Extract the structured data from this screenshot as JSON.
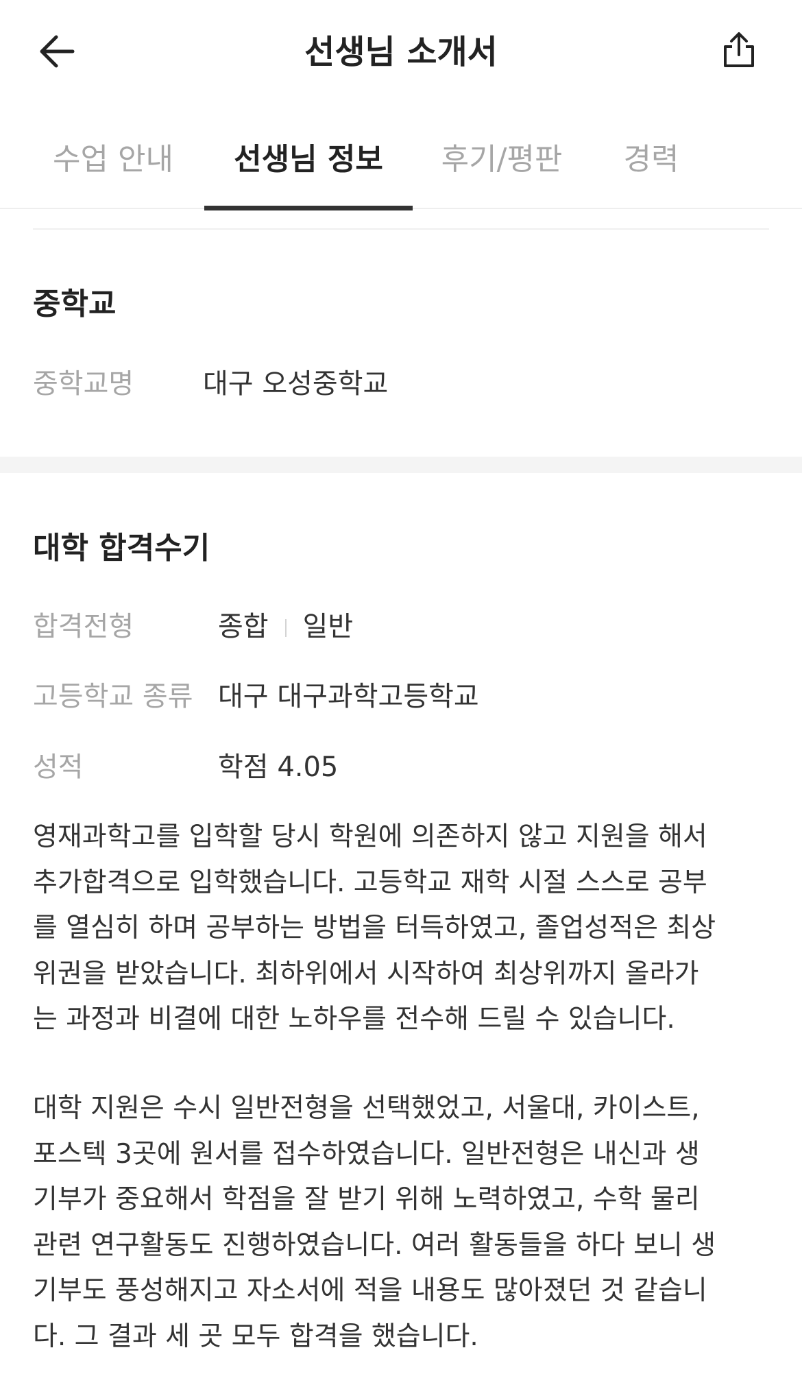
{
  "header": {
    "title": "선생님 소개서",
    "back_icon": "arrow-left-icon",
    "share_icon": "share-icon"
  },
  "tabs": [
    {
      "label": "수업 안내",
      "active": false
    },
    {
      "label": "선생님 정보",
      "active": true
    },
    {
      "label": "후기/평판",
      "active": false
    },
    {
      "label": "경력",
      "active": false
    }
  ],
  "middle_school": {
    "title": "중학교",
    "name_label": "중학교명",
    "name_value": "대구 오성중학교"
  },
  "admission": {
    "title": "대학 합격수기",
    "type_label": "합격전형",
    "type_values": [
      "종합",
      "일반"
    ],
    "school_label": "고등학교 종류",
    "school_value": "대구 대구과학고등학교",
    "grade_label": "성적",
    "grade_value": "학점 4.05",
    "paragraph1": "영재과학고를 입학할 당시 학원에 의존하지 않고 지원을 해서\n추가합격으로 입학했습니다. 고등학교 재학 시절 스스로 공부\n를 열심히 하며 공부하는 방법을 터득하였고, 졸업성적은 최상\n위권을 받았습니다. 최하위에서 시작하여 최상위까지 올라가\n는 과정과 비결에 대한 노하우를 전수해 드릴 수 있습니다.",
    "paragraph2": "대학 지원은 수시 일반전형을 선택했었고, 서울대, 카이스트,\n포스텍 3곳에 원서를 접수하였습니다. 일반전형은 내신과 생\n기부가 중요해서 학점을 잘 받기 위해 노력하였고, 수학 물리\n관련 연구활동도 진행하였습니다. 여러 활동들을 하다 보니 생\n기부도 풍성해지고 자소서에 적을 내용도 많아졌던 것 같습니\n다. 그 결과 세 곳 모두 합격을 했습니다."
  },
  "colors": {
    "text_primary": "#222222",
    "text_secondary": "#a6a6a6",
    "tab_indicator": "#333333",
    "section_band": "#f4f4f4"
  }
}
